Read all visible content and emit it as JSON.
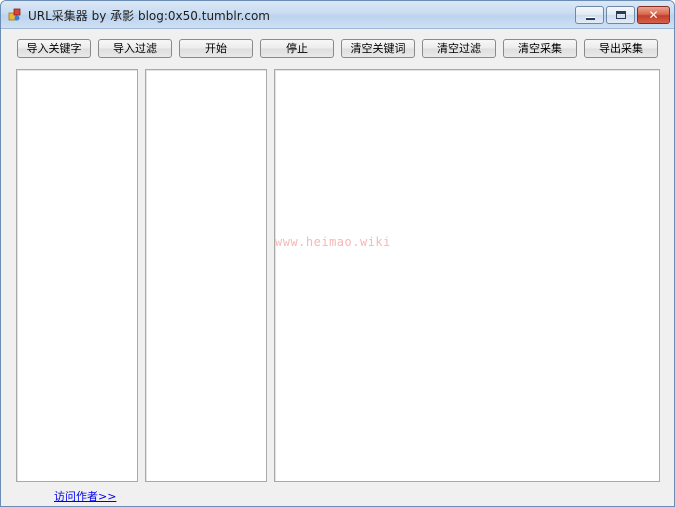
{
  "window": {
    "title": "URL采集器 by 承影 blog:0x50.tumblr.com",
    "close_glyph": "✕"
  },
  "toolbar": {
    "buttons": [
      "导入关键字",
      "导入过滤",
      "开始",
      "停止",
      "清空关键词",
      "清空过滤",
      "清空采集",
      "导出采集"
    ]
  },
  "watermark": "www.heimao.wiki",
  "footer": {
    "visit_author": "访问作者>>"
  },
  "colors": {
    "link": "#0000ee",
    "watermark": "#f5b8b8",
    "close_button": "#c0402a"
  }
}
